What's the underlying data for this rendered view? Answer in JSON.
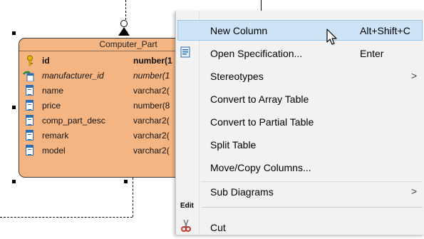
{
  "entity": {
    "title": "Computer_Part",
    "columns": [
      {
        "name": "id",
        "type": "number(1",
        "key": "primary",
        "icon": "key-icon"
      },
      {
        "name": "manufacturer_id",
        "type": "number(1",
        "key": "foreign",
        "icon": "foreign-key-icon"
      },
      {
        "name": "name",
        "type": "varchar2(",
        "key": "",
        "icon": "column-icon"
      },
      {
        "name": "price",
        "type": "number(8",
        "key": "",
        "icon": "column-icon"
      },
      {
        "name": "comp_part_desc",
        "type": "varchar2(",
        "key": "",
        "icon": "column-icon"
      },
      {
        "name": "remark",
        "type": "varchar2(",
        "key": "",
        "icon": "column-icon"
      },
      {
        "name": "model",
        "type": "varchar2(",
        "key": "",
        "icon": "column-icon"
      }
    ],
    "fill_color": "#f5b583"
  },
  "menu": {
    "items": [
      {
        "label": "New Column",
        "shortcut": "Alt+Shift+C",
        "highlighted": true
      },
      {
        "label": "Open Specification...",
        "shortcut": "Enter",
        "icon": "specification-icon"
      },
      {
        "label": "Stereotypes",
        "submenu": ">"
      },
      {
        "label": "Convert to Array Table"
      },
      {
        "label": "Convert to Partial Table"
      },
      {
        "label": "Split Table"
      },
      {
        "label": "Move/Copy Columns..."
      },
      {
        "label": "Sub Diagrams",
        "submenu": ">"
      }
    ],
    "group_label": "Edit",
    "edit_items": [
      {
        "label": "Cut",
        "icon": "scissors-icon"
      }
    ],
    "highlight_color": "#cde4f7"
  }
}
